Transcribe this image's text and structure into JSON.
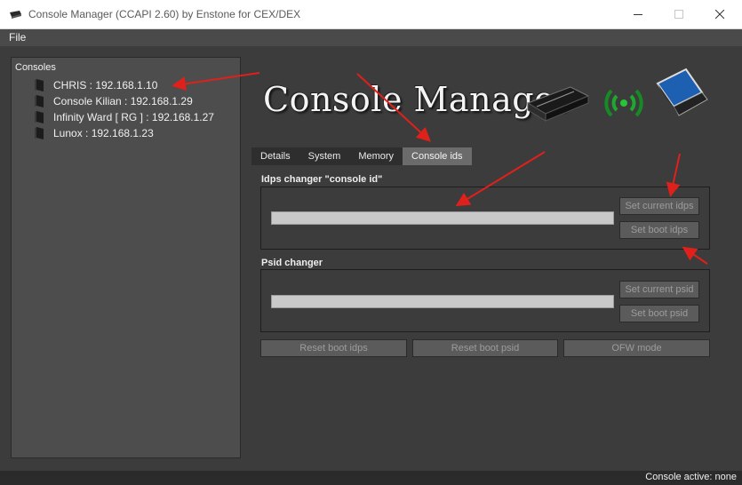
{
  "window": {
    "title": "Console Manager (CCAPI 2.60) by Enstone for CEX/DEX",
    "minimize_icon": "minimize-icon",
    "maximize_icon": "maximize-icon",
    "close_icon": "close-icon"
  },
  "menu": {
    "file": "File"
  },
  "consoles": {
    "header": "Consoles",
    "items": [
      {
        "label": "CHRIS : 192.168.1.10"
      },
      {
        "label": "Console Kilian : 192.168.1.29"
      },
      {
        "label": "Infinity Ward [ RG ]  : 192.168.1.27"
      },
      {
        "label": "Lunox : 192.168.1.23"
      }
    ]
  },
  "logo": {
    "text": "Console Manager"
  },
  "tabs": [
    {
      "label": "Details"
    },
    {
      "label": "System"
    },
    {
      "label": "Memory"
    },
    {
      "label": "Console ids",
      "active": true
    }
  ],
  "idps": {
    "title": "Idps changer \"console id\"",
    "set_current": "Set current idps",
    "set_boot": "Set boot idps"
  },
  "psid": {
    "title": "Psid changer",
    "set_current": "Set current psid",
    "set_boot": "Set boot psid"
  },
  "actions": {
    "reset_boot_idps": "Reset boot idps",
    "reset_boot_psid": "Reset boot psid",
    "ofw_mode": "OFW mode"
  },
  "status": {
    "text": "Console active: none"
  },
  "colors": {
    "annotation_arrow": "#e0201a",
    "active_tab": "#6b6b6b",
    "field": "#c9c9c9"
  }
}
